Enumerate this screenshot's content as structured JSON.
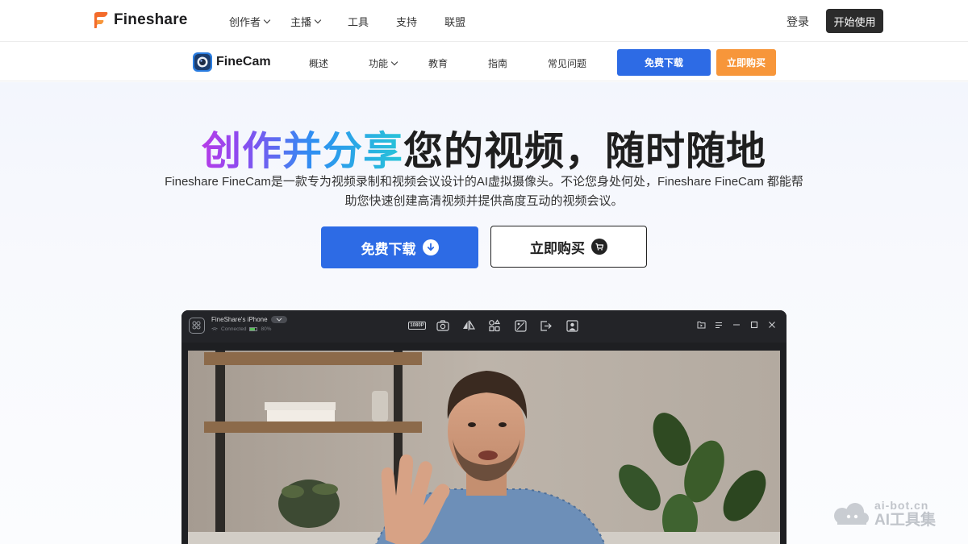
{
  "topnav": {
    "brand": "Fineshare",
    "menu": [
      {
        "label": "创作者",
        "dropdown": true
      },
      {
        "label": "主播",
        "dropdown": true
      },
      {
        "label": "工具",
        "dropdown": false
      },
      {
        "label": "支持",
        "dropdown": false
      },
      {
        "label": "联盟",
        "dropdown": false
      }
    ],
    "login": "登录",
    "start": "开始使用"
  },
  "subnav": {
    "product": "FineCam",
    "menu": [
      {
        "label": "概述",
        "dropdown": false
      },
      {
        "label": "功能",
        "dropdown": true
      },
      {
        "label": "教育",
        "dropdown": false
      },
      {
        "label": "指南",
        "dropdown": false
      },
      {
        "label": "常见问题",
        "dropdown": false
      }
    ],
    "download": "免费下载",
    "buy": "立即购买"
  },
  "hero": {
    "headline_gradient": "创作并分享",
    "headline_rest": "您的视频，随时随地",
    "description": "Fineshare FineCam是一款专为视频录制和视频会议设计的AI虚拟摄像头。不论您身处何处，Fineshare FineCam 都能帮助您快速创建高清视频并提供高度互动的视频会议。",
    "download": "免费下载",
    "buy": "立即购买"
  },
  "app": {
    "device_name": "FineShare's iPhone",
    "status": "Connected",
    "battery": "80%",
    "resolution_badge": "1080P",
    "tools": [
      "resolution-icon",
      "camera-icon",
      "mirror-icon",
      "effects-icon",
      "background-icon",
      "exit-icon",
      "portrait-icon"
    ],
    "window_controls": [
      "folder-icon",
      "menu-icon",
      "minimize-icon",
      "maximize-icon",
      "close-icon"
    ]
  },
  "watermark": {
    "domain": "ai-bot.cn",
    "name": "AI工具集"
  },
  "colors": {
    "primary_blue": "#2d6be5",
    "orange": "#f7963a",
    "dark": "#2b2b2b"
  }
}
